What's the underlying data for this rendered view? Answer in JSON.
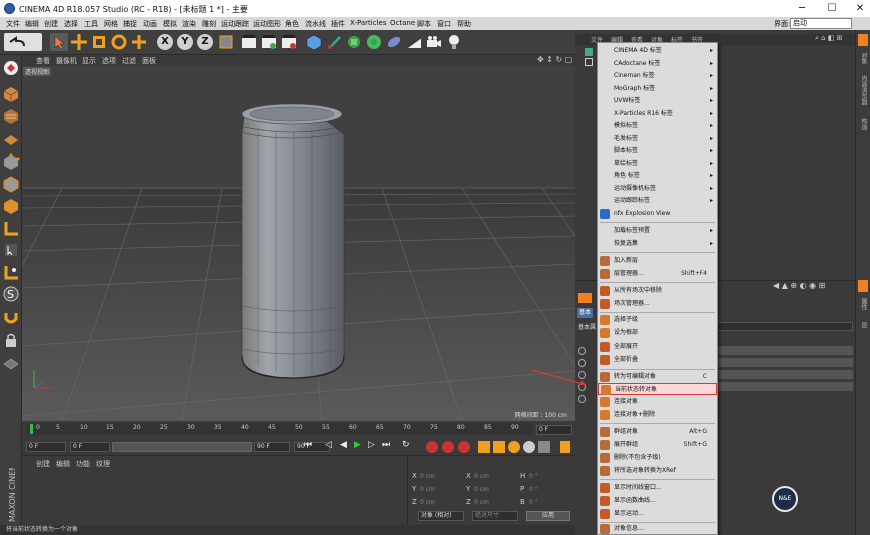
{
  "window": {
    "title": "CINEMA 4D R18.057 Studio (RC - R18) - [未标题 1 *] - 主要",
    "minimize": "─",
    "maximize": "☐",
    "close": "✕"
  },
  "menubar": {
    "items": [
      "文件",
      "编辑",
      "创建",
      "选择",
      "工具",
      "网格",
      "捕捉",
      "动画",
      "模拟",
      "渲染",
      "雕刻",
      "运动跟踪",
      "运动图形",
      "角色",
      "流水线",
      "插件",
      "X-Particles",
      "Octane",
      "脚本",
      "窗口",
      "帮助"
    ],
    "layout_label": "界面:",
    "layout_value": "启动"
  },
  "toolbar": {
    "x": "X",
    "y": "Y",
    "z": "Z"
  },
  "viewport": {
    "menu": [
      "查看",
      "摄像机",
      "显示",
      "选项",
      "过滤",
      "面板"
    ],
    "label": "透视视图",
    "grid_distance": "网格间距 : 100 cm"
  },
  "timeline": {
    "ticks": [
      "0",
      "5",
      "10",
      "15",
      "20",
      "25",
      "30",
      "35",
      "40",
      "45",
      "50",
      "55",
      "60",
      "65",
      "70",
      "75",
      "80",
      "85",
      "90"
    ],
    "frame_end": "0 F"
  },
  "transport": {
    "start": "0 F",
    "current": "0 F",
    "end_preview": "90 F",
    "end": "90 F"
  },
  "material_panel": {
    "menu": [
      "创建",
      "编辑",
      "功能",
      "纹理"
    ]
  },
  "coord_panel": {
    "col1": [
      "X",
      "Y",
      "Z"
    ],
    "col2": [
      "X",
      "Y",
      "Z"
    ],
    "col3": [
      "H",
      "P",
      "B"
    ],
    "pos_value": "0 cm",
    "rot_value": "0 °",
    "mode": "对象 (相对)",
    "size_mode": "绝对尺寸",
    "apply": "应用"
  },
  "statusbar": {
    "text": "将当前状态转换为一个对象"
  },
  "object_manager": {
    "menu": [
      "文件",
      "编辑",
      "查看",
      "对象",
      "标签",
      "书签"
    ]
  },
  "attribute_manager": {
    "tab_basic": "基本",
    "tab_basic2": "基本属"
  },
  "right_tabs": [
    "对象",
    "内容浏览器",
    "构造",
    "属性",
    "层"
  ],
  "context_menu": {
    "items": [
      {
        "label": "CINEMA 4D 标签",
        "sub": "▸"
      },
      {
        "label": "CAdoctane 标签",
        "sub": "▸"
      },
      {
        "label": "Cineman 标签",
        "sub": "▸"
      },
      {
        "label": "MoGraph 标签",
        "sub": "▸"
      },
      {
        "label": "UVW标签",
        "sub": "▸"
      },
      {
        "label": "X-Particles R16 标签",
        "sub": "▸"
      },
      {
        "label": "模拟标签",
        "sub": "▸"
      },
      {
        "label": "毛发标签",
        "sub": "▸"
      },
      {
        "label": "脚本标签",
        "sub": "▸"
      },
      {
        "label": "草绘标签",
        "sub": "▸"
      },
      {
        "label": "角色 标签",
        "sub": "▸"
      },
      {
        "label": "运动摄像机标签",
        "sub": "▸"
      },
      {
        "label": "运动跟踪标签",
        "sub": "▸"
      },
      {
        "label": "nfx Explosion View",
        "sub": ""
      },
      {
        "label": "加载标签预置",
        "sub": "▸"
      },
      {
        "label": "恢复选集",
        "sub": "▸"
      },
      {
        "label": "加入新层",
        "sub": ""
      },
      {
        "label": "层管理器...",
        "shortcut": "Shift+F4"
      },
      {
        "label": "从所有场次中移除",
        "sub": ""
      },
      {
        "label": "场次管理器...",
        "sub": ""
      },
      {
        "label": "选择子级",
        "sub": ""
      },
      {
        "label": "设为根部",
        "sub": ""
      },
      {
        "label": "全部展开",
        "sub": ""
      },
      {
        "label": "全部折叠",
        "sub": ""
      },
      {
        "label": "转为可编辑对象",
        "shortcut": "C"
      },
      {
        "label": "当前状态转对象",
        "sub": ""
      },
      {
        "label": "连接对象",
        "sub": ""
      },
      {
        "label": "连接对象+删除",
        "sub": ""
      },
      {
        "label": "群组对象",
        "shortcut": "Alt+G"
      },
      {
        "label": "展开群组",
        "shortcut": "Shift+G"
      },
      {
        "label": "删除(不包含子级)",
        "sub": ""
      },
      {
        "label": "将所选对象转换为XRef",
        "sub": ""
      },
      {
        "label": "显示时间线窗口...",
        "sub": ""
      },
      {
        "label": "显示函数曲线...",
        "sub": ""
      },
      {
        "label": "显示运动...",
        "sub": ""
      },
      {
        "label": "对象信息...",
        "sub": ""
      }
    ]
  },
  "badge": {
    "text": "N&E"
  },
  "colors": {
    "highlight_border": "#d43a3a",
    "arrow": "#d43a3a",
    "playhead": "#2fbf4a"
  }
}
